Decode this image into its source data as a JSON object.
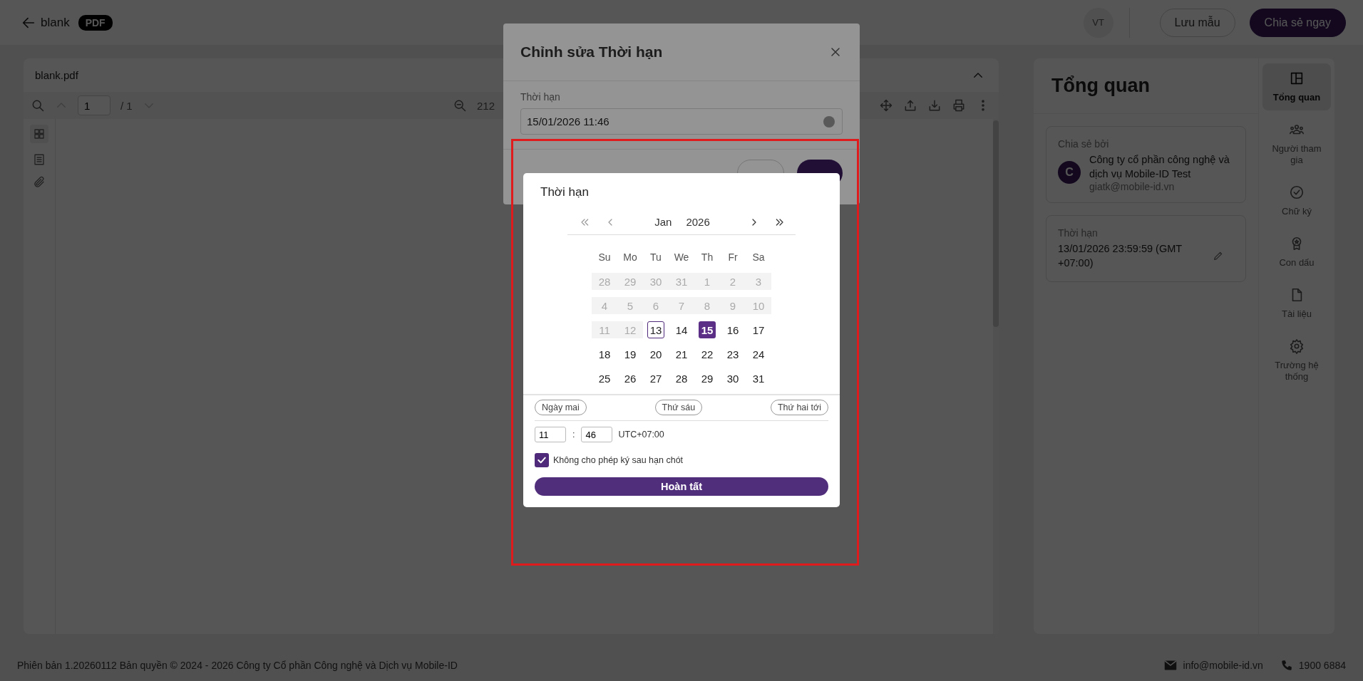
{
  "header": {
    "back_label": "blank",
    "badge": "PDF",
    "avatar": "VT",
    "buttons": [
      {
        "label": "Lưu mẫu",
        "kind": "outline"
      },
      {
        "label": "Chia sẻ ngay",
        "kind": "primary"
      }
    ]
  },
  "viewer": {
    "file_name": "blank.pdf",
    "page_input": "1",
    "page_total": "/ 1",
    "zoom": "212"
  },
  "overview": {
    "title": "Tổng quan",
    "shared_by": {
      "label": "Chia sẻ bởi",
      "avatar": "C",
      "name": "Công ty cổ phần công nghệ và dịch vụ Mobile-ID Test",
      "email": "giatk@mobile-id.vn"
    },
    "deadline": {
      "label": "Thời hạn",
      "value": "13/01/2026 23:59:59 (GMT +07:00)"
    }
  },
  "nav": [
    {
      "label": "Tổng quan",
      "selected": true
    },
    {
      "label": "Người tham gia",
      "selected": false
    },
    {
      "label": "Chữ ký",
      "selected": false
    },
    {
      "label": "Con dấu",
      "selected": false
    },
    {
      "label": "Tài liệu",
      "selected": false
    },
    {
      "label": "Trường hệ thống",
      "selected": false
    }
  ],
  "edit_dialog": {
    "title": "Chỉnh sửa Thời hạn",
    "field_label": "Thời hạn",
    "field_value": "15/01/2026 11:46"
  },
  "picker": {
    "title": "Thời hạn",
    "month": "Jan",
    "year": "2026",
    "weekdays": [
      "Su",
      "Mo",
      "Tu",
      "We",
      "Th",
      "Fr",
      "Sa"
    ],
    "weeks": [
      [
        {
          "day": "28",
          "disabled": true,
          "today": false,
          "selected": false
        },
        {
          "day": "29",
          "disabled": true,
          "today": false,
          "selected": false
        },
        {
          "day": "30",
          "disabled": true,
          "today": false,
          "selected": false
        },
        {
          "day": "31",
          "disabled": true,
          "today": false,
          "selected": false
        },
        {
          "day": "1",
          "disabled": true,
          "today": false,
          "selected": false
        },
        {
          "day": "2",
          "disabled": true,
          "today": false,
          "selected": false
        },
        {
          "day": "3",
          "disabled": true,
          "today": false,
          "selected": false
        }
      ],
      [
        {
          "day": "4",
          "disabled": true,
          "today": false,
          "selected": false
        },
        {
          "day": "5",
          "disabled": true,
          "today": false,
          "selected": false
        },
        {
          "day": "6",
          "disabled": true,
          "today": false,
          "selected": false
        },
        {
          "day": "7",
          "disabled": true,
          "today": false,
          "selected": false
        },
        {
          "day": "8",
          "disabled": true,
          "today": false,
          "selected": false
        },
        {
          "day": "9",
          "disabled": true,
          "today": false,
          "selected": false
        },
        {
          "day": "10",
          "disabled": true,
          "today": false,
          "selected": false
        }
      ],
      [
        {
          "day": "11",
          "disabled": true,
          "today": false,
          "selected": false
        },
        {
          "day": "12",
          "disabled": true,
          "today": false,
          "selected": false
        },
        {
          "day": "13",
          "disabled": false,
          "today": true,
          "selected": false
        },
        {
          "day": "14",
          "disabled": false,
          "today": false,
          "selected": false
        },
        {
          "day": "15",
          "disabled": false,
          "today": false,
          "selected": true
        },
        {
          "day": "16",
          "disabled": false,
          "today": false,
          "selected": false
        },
        {
          "day": "17",
          "disabled": false,
          "today": false,
          "selected": false
        }
      ],
      [
        {
          "day": "18",
          "disabled": false,
          "today": false,
          "selected": false
        },
        {
          "day": "19",
          "disabled": false,
          "today": false,
          "selected": false
        },
        {
          "day": "20",
          "disabled": false,
          "today": false,
          "selected": false
        },
        {
          "day": "21",
          "disabled": false,
          "today": false,
          "selected": false
        },
        {
          "day": "22",
          "disabled": false,
          "today": false,
          "selected": false
        },
        {
          "day": "23",
          "disabled": false,
          "today": false,
          "selected": false
        },
        {
          "day": "24",
          "disabled": false,
          "today": false,
          "selected": false
        }
      ],
      [
        {
          "day": "25",
          "disabled": false,
          "today": false,
          "selected": false
        },
        {
          "day": "26",
          "disabled": false,
          "today": false,
          "selected": false
        },
        {
          "day": "27",
          "disabled": false,
          "today": false,
          "selected": false
        },
        {
          "day": "28",
          "disabled": false,
          "today": false,
          "selected": false
        },
        {
          "day": "29",
          "disabled": false,
          "today": false,
          "selected": false
        },
        {
          "day": "30",
          "disabled": false,
          "today": false,
          "selected": false
        },
        {
          "day": "31",
          "disabled": false,
          "today": false,
          "selected": false
        }
      ]
    ],
    "shortcuts": [
      "Ngày mai",
      "Thứ sáu",
      "Thứ hai tới"
    ],
    "hour": "11",
    "separator": ":",
    "minute": "46",
    "timezone": "UTC+07:00",
    "lock": {
      "label": "Không cho phép ký sau hạn chót",
      "checked": true
    },
    "done": "Hoàn tất"
  },
  "footer": {
    "text": "Phiên bản 1.20260112 Bản quyền © 2024 - 2026 Công ty Cổ phần Công nghệ và Dịch vụ Mobile-ID",
    "email": "info@mobile-id.vn",
    "phone": "1900 6884"
  }
}
